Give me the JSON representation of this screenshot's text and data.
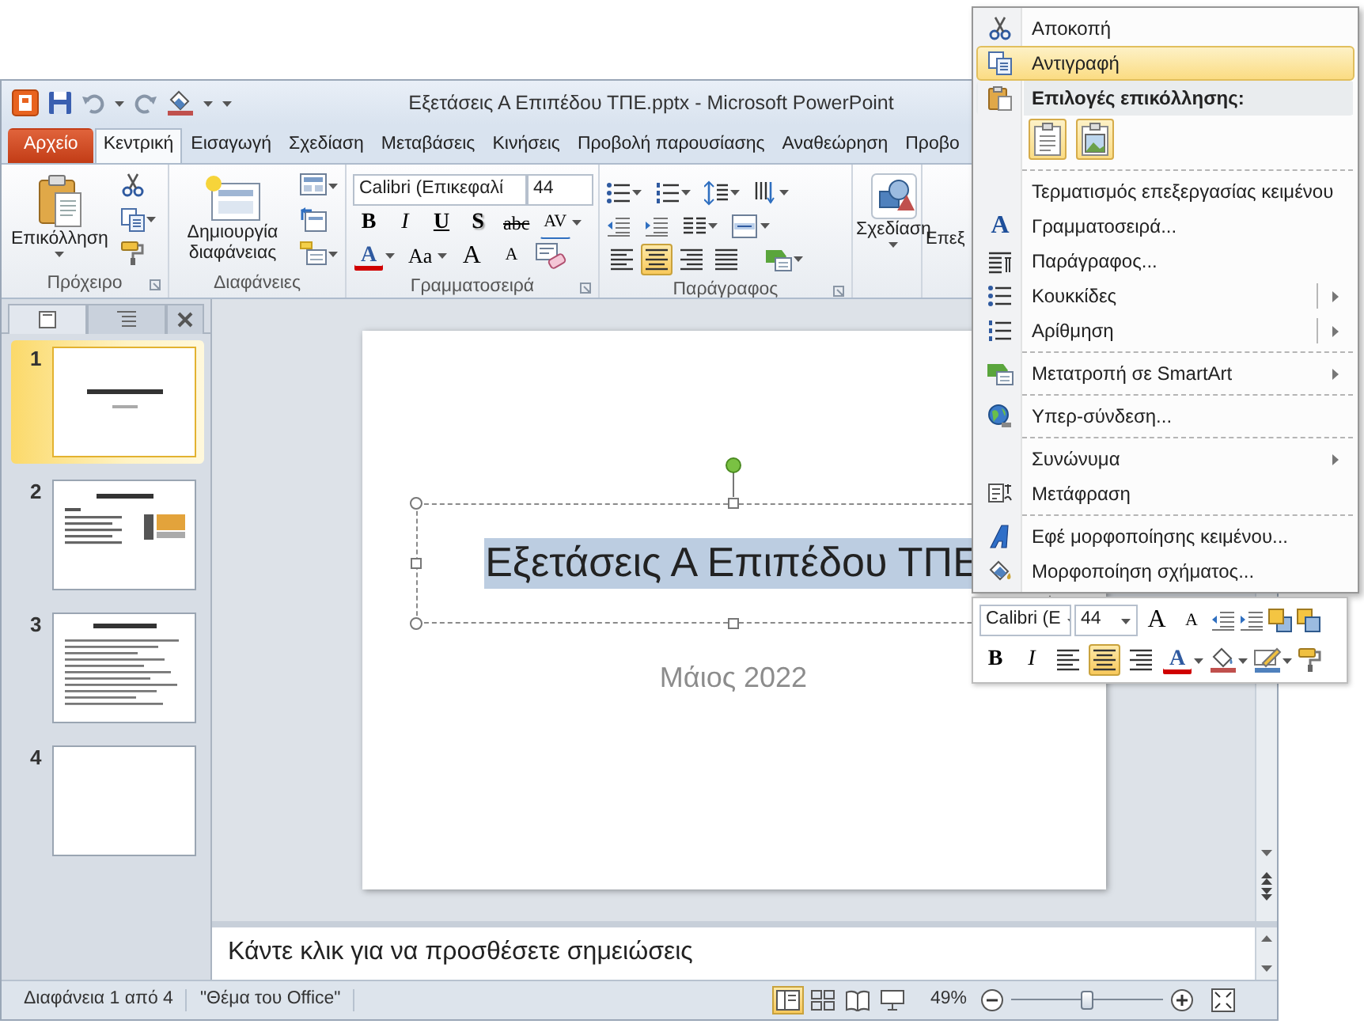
{
  "window": {
    "title": "Εξετάσεις Α Επιπέδου ΤΠΕ.pptx  -  Microsoft PowerPoint"
  },
  "tabs": [
    {
      "label": "Αρχείο",
      "kind": "file",
      "selected": false
    },
    {
      "label": "Κεντρική",
      "kind": "tab",
      "selected": true
    },
    {
      "label": "Εισαγωγή",
      "kind": "tab",
      "selected": false
    },
    {
      "label": "Σχεδίαση",
      "kind": "tab",
      "selected": false
    },
    {
      "label": "Μεταβάσεις",
      "kind": "tab",
      "selected": false
    },
    {
      "label": "Κινήσεις",
      "kind": "tab",
      "selected": false
    },
    {
      "label": "Προβολή παρουσίασης",
      "kind": "tab",
      "selected": false
    },
    {
      "label": "Αναθεώρηση",
      "kind": "tab",
      "selected": false
    },
    {
      "label": "Προβο",
      "kind": "tab",
      "selected": false
    }
  ],
  "ribbon": {
    "clipboard": {
      "label": "Πρόχειρο",
      "paste": "Επικόλληση"
    },
    "slides": {
      "label": "Διαφάνειες",
      "new_slide": "Δημιουργία διαφάνειας"
    },
    "font": {
      "label": "Γραμματοσειρά",
      "font_name": "Calibri (Επικεφαλί",
      "font_size": "44",
      "row_1": [
        {
          "label": "B",
          "kind": "bold"
        },
        {
          "label": "I",
          "kind": "italic"
        },
        {
          "label": "U",
          "kind": "underline"
        },
        {
          "label": "S",
          "kind": "shadow"
        },
        {
          "label": "abc",
          "kind": "strike"
        },
        {
          "label": "AV",
          "kind": "spacing"
        }
      ],
      "row_2": [
        {
          "label": "A",
          "kind": "color"
        },
        {
          "label": "Aa",
          "kind": "case"
        },
        {
          "label": "A",
          "kind": "grow"
        },
        {
          "label": "A",
          "kind": "shrink"
        },
        {
          "kind": "clear"
        }
      ]
    },
    "paragraph": {
      "label": "Παράγραφος",
      "alignments": [
        {
          "kind": "left",
          "selected": false
        },
        {
          "kind": "center",
          "selected": true
        },
        {
          "kind": "right",
          "selected": false
        },
        {
          "kind": "justify",
          "selected": false
        }
      ]
    },
    "drawing": {
      "label": "Σχεδίαση"
    },
    "editing": {
      "label": "Επεξ"
    }
  },
  "slides_pane": {
    "thumbnails": [
      {
        "number": "1",
        "kind": "title",
        "selected": true
      },
      {
        "number": "2",
        "kind": "content",
        "selected": false
      },
      {
        "number": "3",
        "kind": "list",
        "selected": false
      },
      {
        "number": "4",
        "kind": "blank",
        "selected": false
      }
    ]
  },
  "slide": {
    "title": "Εξετάσεις Α Επιπέδου ΤΠΕ",
    "subtitle": "Μάιος 2022"
  },
  "notes": {
    "text": "Κάντε κλικ για να προσθέσετε σημειώσεις"
  },
  "status_bar": {
    "slide": "Διαφάνεια 1 από 4",
    "theme": "\"Θέμα του Office\"",
    "views": [
      {
        "kind": "normal",
        "selected": true
      },
      {
        "kind": "sorter",
        "selected": false
      },
      {
        "kind": "reading",
        "selected": false
      },
      {
        "kind": "slideshow",
        "selected": false
      }
    ],
    "zoom": "49%",
    "zoom_slider": {
      "level": 0.5
    }
  },
  "context_menu": {
    "items": [
      {
        "label": "Αποκοπή",
        "kind": "item",
        "highlighted": false,
        "separated": false
      },
      {
        "label": "Αντιγραφή",
        "kind": "item",
        "highlighted": true,
        "separated": false
      },
      {
        "label": "Επιλογές επικόλλησης:",
        "kind": "header"
      },
      {
        "kind": "paste_options",
        "options": [
          {
            "kind": "text"
          },
          {
            "kind": "picture"
          }
        ]
      },
      {
        "label": "Τερματισμός επεξεργασίας κειμένου",
        "kind": "item",
        "highlighted": false,
        "separated": true
      },
      {
        "label": "Γραμματοσειρά...",
        "glyph": "A",
        "kind": "item",
        "highlighted": false,
        "separated": false
      },
      {
        "label": "Παράγραφος...",
        "kind": "item",
        "highlighted": false,
        "separated": false
      },
      {
        "label": "Κουκκίδες",
        "kind": "item",
        "highlighted": false,
        "separated": false,
        "submenu": true,
        "split": true
      },
      {
        "label": "Αρίθμηση",
        "kind": "item",
        "highlighted": false,
        "separated": false,
        "submenu": true,
        "split": true
      },
      {
        "label": "Μετατροπή σε SmartArt",
        "kind": "item",
        "highlighted": false,
        "separated": true,
        "submenu": true,
        "split": false
      },
      {
        "label": "Υπερ-σύνδεση...",
        "kind": "item",
        "highlighted": false,
        "separated": true
      },
      {
        "label": "Συνώνυμα",
        "kind": "item",
        "highlighted": false,
        "separated": true,
        "submenu": true,
        "split": false
      },
      {
        "label": "Μετάφραση",
        "kind": "item",
        "highlighted": false,
        "separated": false
      },
      {
        "label": "Εφέ μορφοποίησης κειμένου...",
        "kind": "item",
        "highlighted": false,
        "separated": true
      },
      {
        "label": "Μορφοποίηση σχήματος...",
        "kind": "item",
        "highlighted": false,
        "separated": false
      }
    ]
  },
  "mini_toolbar": {
    "font_name": "Calibri (E",
    "font_size": "44",
    "row_1": [
      {
        "label": "A",
        "kind": "grow"
      },
      {
        "label": "A",
        "kind": "shrink"
      },
      {
        "kind": "outdent"
      },
      {
        "kind": "indent"
      },
      {
        "kind": "forward"
      },
      {
        "kind": "backward"
      }
    ],
    "format": [
      {
        "label": "B",
        "kind": "bold"
      },
      {
        "label": "I",
        "kind": "italic"
      }
    ],
    "alignments": [
      {
        "kind": "left",
        "selected": false
      },
      {
        "kind": "center",
        "selected": true
      },
      {
        "kind": "right",
        "selected": false
      }
    ],
    "colors": [
      {
        "label": "A",
        "kind": "color"
      },
      {
        "kind": "fill"
      },
      {
        "kind": "line"
      },
      {
        "kind": "painter"
      }
    ]
  }
}
